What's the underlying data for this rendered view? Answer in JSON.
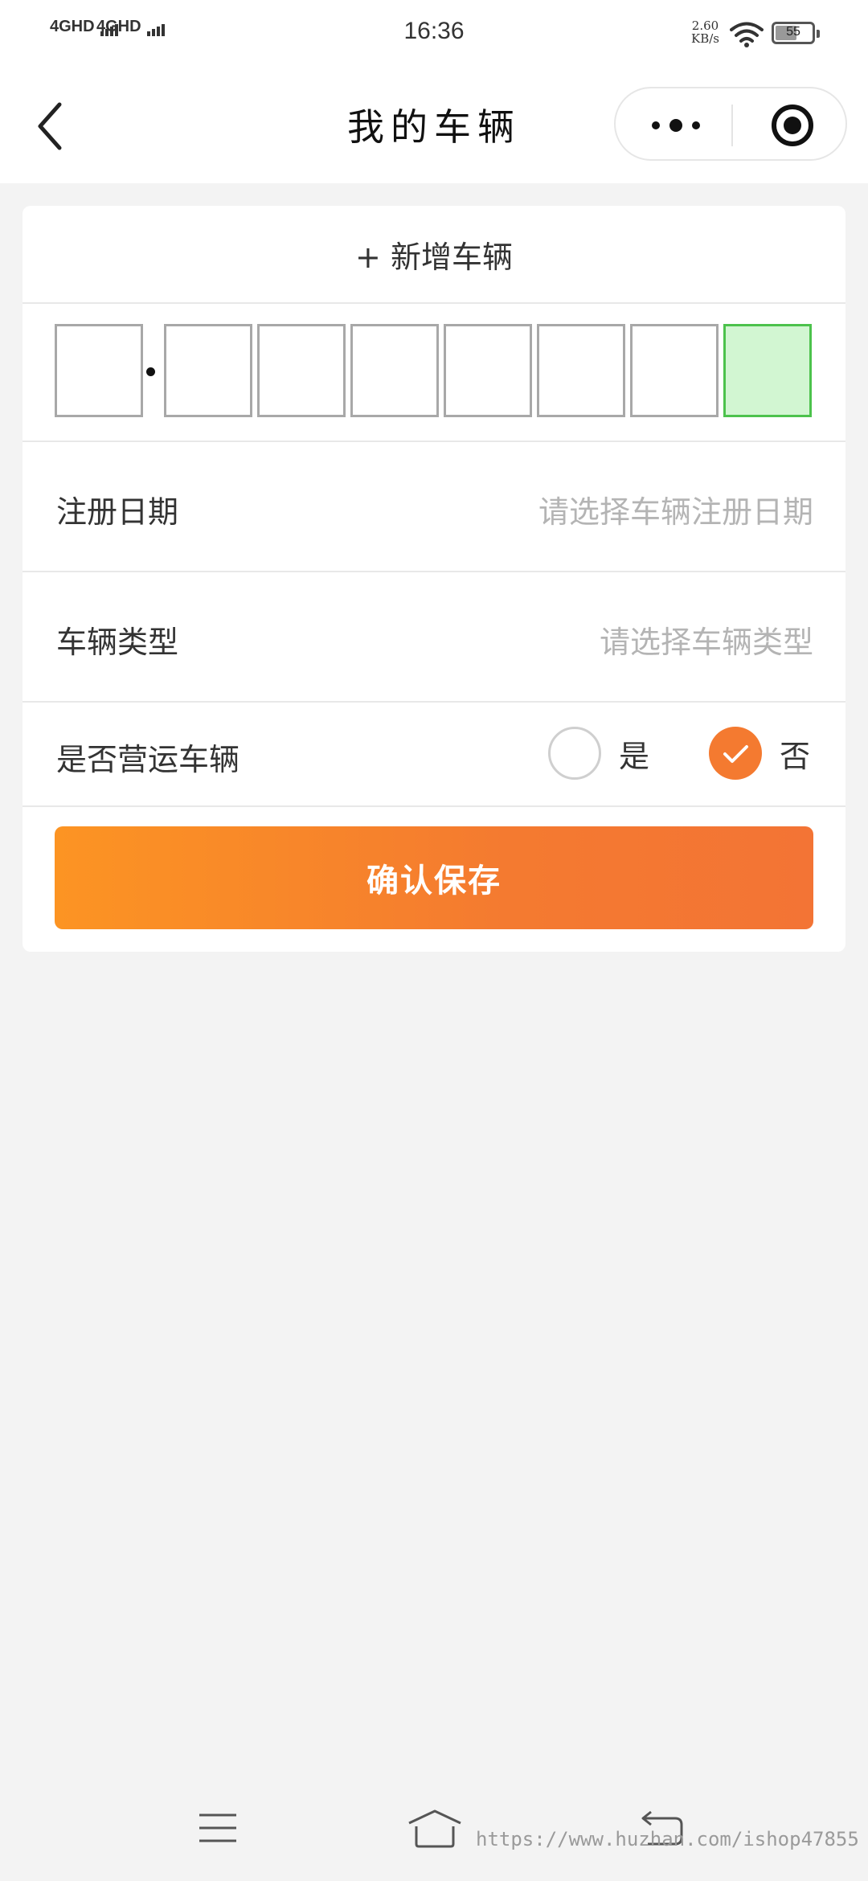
{
  "status_bar": {
    "network_1": "4GHD",
    "network_2": "4GHD",
    "time": "16:36",
    "net_speed_value": "2.60",
    "net_speed_unit": "KB/s",
    "battery_level": "55"
  },
  "nav": {
    "title": "我的车辆",
    "back_icon": "chevron-left-icon",
    "more_icon": "more-dots-icon",
    "close_icon": "target-circle-icon"
  },
  "card": {
    "add_vehicle_label": "+ 新增车辆",
    "plate_boxes": [
      "",
      "",
      "",
      "",
      "",
      "",
      "",
      ""
    ],
    "plate_active_index": 7,
    "register_date": {
      "label": "注册日期",
      "placeholder": "请选择车辆注册日期"
    },
    "vehicle_type": {
      "label": "车辆类型",
      "placeholder": "请选择车辆类型"
    },
    "commercial": {
      "label": "是否营运车辆",
      "options": [
        {
          "label": "是",
          "selected": false
        },
        {
          "label": "否",
          "selected": true
        }
      ]
    },
    "save_label": "确认保存"
  },
  "colors": {
    "accent": "#f47a30",
    "active_plate_border": "#4cc24c",
    "active_plate_fill": "#d2f6d2"
  },
  "system_nav": {
    "menu_icon": "menu-lines-icon",
    "home_icon": "home-icon",
    "back_icon": "return-icon",
    "watermark": "https://www.huzhan.com/ishop47855"
  }
}
